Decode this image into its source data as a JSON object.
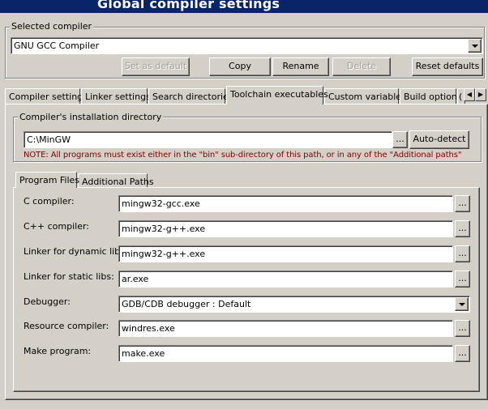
{
  "window": {
    "title": "Global compiler settings"
  },
  "selected_compiler": {
    "legend": "Selected compiler",
    "value": "GNU GCC Compiler",
    "buttons": {
      "set_default": "Set as default",
      "copy": "Copy",
      "rename": "Rename",
      "delete": "Delete",
      "reset_defaults": "Reset defaults"
    }
  },
  "tabs": [
    {
      "label": "Compiler settings"
    },
    {
      "label": "Linker settings"
    },
    {
      "label": "Search directories"
    },
    {
      "label": "Toolchain executables"
    },
    {
      "label": "Custom variables"
    },
    {
      "label": "Build options"
    },
    {
      "label": "("
    }
  ],
  "active_tab": "Toolchain executables",
  "install_dir": {
    "legend": "Compiler's installation directory",
    "value": "C:\\MinGW",
    "browse": "...",
    "auto_detect": "Auto-detect",
    "note": "NOTE: All programs must exist either in the \"bin\" sub-directory of this path, or in any of the \"Additional paths\"",
    "note_color": "#800000"
  },
  "subtabs": [
    {
      "label": "Program Files"
    },
    {
      "label": "Additional Paths"
    }
  ],
  "programs": [
    {
      "label": "C compiler:",
      "value": "mingw32-gcc.exe"
    },
    {
      "label": "C++ compiler:",
      "value": "mingw32-g++.exe"
    },
    {
      "label": "Linker for dynamic libs:",
      "value": "mingw32-g++.exe"
    },
    {
      "label": "Linker for static libs:",
      "value": "ar.exe"
    },
    {
      "label": "Debugger:",
      "value": "GDB/CDB debugger : Default"
    },
    {
      "label": "Resource compiler:",
      "value": "windres.exe"
    },
    {
      "label": "Make program:",
      "value": "make.exe"
    }
  ],
  "browse_label": "...",
  "colors": {
    "titlebar": "#0a246a",
    "face": "#d4d0c8"
  }
}
